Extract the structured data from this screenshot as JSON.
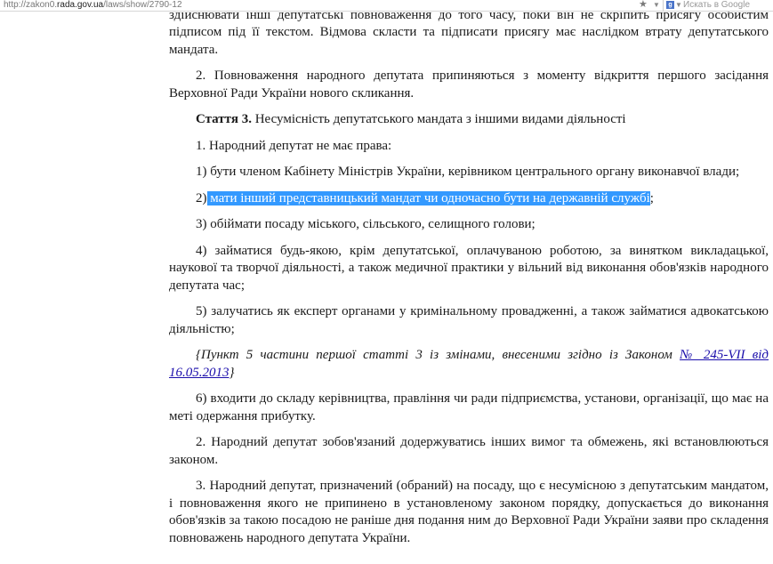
{
  "browser": {
    "url_prefix": "http://zakon0.",
    "url_host": "rada.gov.ua",
    "url_suffix": "/laws/show/2790-12",
    "search_placeholder": "Искать в Google",
    "search_engine_letter": "g"
  },
  "article": {
    "p0": "Народний депутат не може брати участі у засіданнях Верховної Ради України та її органів, а також здійснювати інші депутатські повноваження до того часу, поки він не скріпить присягу особистим підписом під її текстом. Відмова скласти та підписати присягу має наслідком втрату депутатського мандата.",
    "p1": "2. Повноваження народного депутата припиняються з моменту відкриття першого засідання Верховної Ради України нового скликання.",
    "heading_label": "Стаття 3.",
    "heading_text": " Несумісність депутатського мандата з іншими видами діяльності",
    "p2": "1. Народний депутат не має права:",
    "p3": "1) бути членом Кабінету Міністрів України, керівником центрального органу виконавчої влади;",
    "p4_num": "2)",
    "p4_selected": " мати інший представницький мандат чи одночасно бути на державній службі",
    "p4_end": ";",
    "p5": "3) обіймати посаду міського, сільського, селищного голови;",
    "p6": "4) займатися будь-якою, крім депутатської, оплачуваною роботою, за винятком викладацької, наукової та творчої діяльності, а також медичної практики у вільний від виконання обов'язків народного депутата час;",
    "p7": "5) залучатись як експерт органами у кримінальному провадженні, а також займатися адвокатською діяльністю;",
    "note_text": "{Пункт 5 частини першої статті 3 із змінами, внесеними згідно із Законом ",
    "note_link": "№ 245-VII від 16.05.2013",
    "note_end": "}",
    "p8": "6) входити до складу керівництва, правління чи ради підприємства, установи, організації, що має на меті одержання прибутку.",
    "p9": "2. Народний депутат зобов'язаний додержуватись інших вимог та обмежень, які встановлюються законом.",
    "p10": "3. Народний депутат, призначений (обраний) на посаду, що є несумісною з депутатським мандатом, і повноваження якого не припинено в установленому законом порядку, допускається до виконання обов'язків за такою посадою не раніше дня подання ним до Верховної Ради України заяви про складення повноважень народного депутата України."
  },
  "colors": {
    "selection": "#3399ff",
    "link": "#1a0dab"
  }
}
